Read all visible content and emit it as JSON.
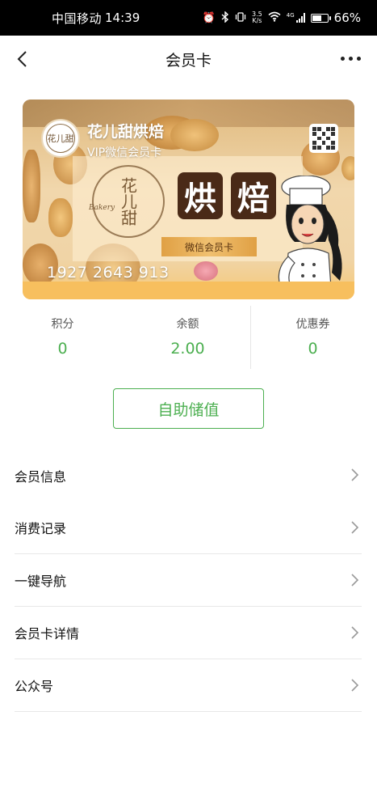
{
  "status_bar": {
    "carrier": "中国移动",
    "time": "14:39",
    "net_speed_value": "3.5",
    "net_speed_unit": "K/s",
    "signal_type": "4G",
    "battery_percent": "66%",
    "battery_level": 0.66,
    "icons": [
      "alarm-icon",
      "bluetooth-icon",
      "vibrate-icon",
      "wifi-icon",
      "signal-icon",
      "battery-icon"
    ]
  },
  "nav": {
    "title": "会员卡",
    "back_icon": "chevron-left-icon",
    "more_icon": "more-icon"
  },
  "card": {
    "shop_name": "花儿甜烘焙",
    "card_type": "VIP微信会员卡",
    "logo_text": "花儿甜",
    "brand_mark": "花儿甜",
    "brand_script": "Bakery",
    "bake_char_1": "烘",
    "bake_char_2": "焙",
    "ribbon_text": "微信会员卡",
    "card_number": "1927 2643 913",
    "qr_icon": "qr-code-icon"
  },
  "stats": [
    {
      "label": "积分",
      "value": "0"
    },
    {
      "label": "余额",
      "value": "2.00"
    },
    {
      "label": "优惠券",
      "value": "0"
    }
  ],
  "recharge_button": "自助储值",
  "menu": [
    {
      "label": "会员信息"
    },
    {
      "label": "消费记录"
    },
    {
      "label": "一键导航"
    },
    {
      "label": "会员卡详情"
    },
    {
      "label": "公众号"
    }
  ],
  "colors": {
    "accent_green": "#4caf50",
    "status_bar_bg": "#000000",
    "card_ribbon": "#f0c070"
  }
}
